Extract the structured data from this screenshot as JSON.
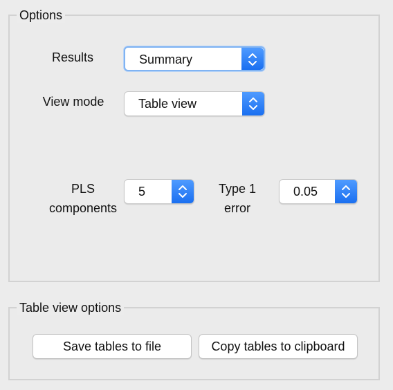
{
  "options": {
    "title": "Options",
    "results": {
      "label": "Results",
      "value": "Summary"
    },
    "view_mode": {
      "label": "View mode",
      "value": "Table view"
    },
    "pls_components": {
      "label_line1": "PLS",
      "label_line2": "components",
      "value": "5"
    },
    "type1_error": {
      "label_line1": "Type 1",
      "label_line2": "error",
      "value": "0.05"
    }
  },
  "table_view_options": {
    "title": "Table view options",
    "save_label": "Save tables to file",
    "copy_label": "Copy tables to clipboard"
  },
  "colors": {
    "accent": "#1a6ff0",
    "focus_ring": "#80b3f2",
    "panel_border": "#d2d2d2",
    "background": "#ececec"
  },
  "icons": {
    "popup_arrows": "chevron-up-down-icon"
  }
}
